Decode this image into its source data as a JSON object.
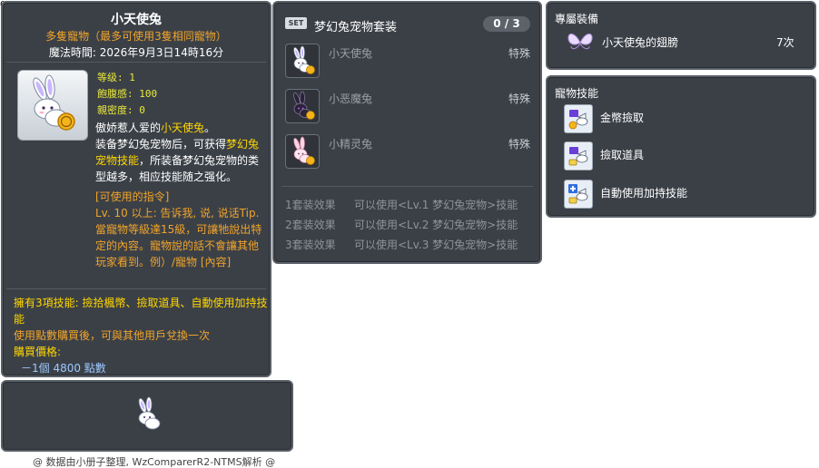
{
  "corner_id": "05002501",
  "item": {
    "title": "小天使兔",
    "subtitle": "多隻寵物（最多可使用3隻相同寵物）",
    "magic_time": "魔法時間:  2026年9月3日14時16分",
    "stats": {
      "level": "等级: 1",
      "fullness": "飽腹感: 100",
      "closeness": "親密度: 0"
    },
    "description": {
      "line1_pre": "傲娇惹人爱的",
      "line1_hl": "小天使兔",
      "line1_post": "。",
      "line2_pre": "装备梦幻兔宠物后，可获得",
      "line2_hl": "梦幻兔宠物技能",
      "line2_post": "，所装备梦幻兔宠物的类型越多，相应技能随之强化。"
    },
    "commands_header": "[可使用的指令]",
    "commands_body": "Lv. 10 以上:  告诉我, 说, 说话Tip. 當寵物等級達15級，可讓牠說出特定的內容。寵物說的話不會讓其他玩家看到。例）/寵物 [內容]",
    "skills_summary": "擁有3項技能: 撿拾楓幣、撿取道具、自動使用加持技能",
    "exchange_note": "使用點數購買後，可與其他用戶兌換一次",
    "price_label": "購買價格:",
    "price": "－1個 4800 點數"
  },
  "footer_credit": "@ 数据由小册子整理, WzComparerR2-NTMS解析 @",
  "set": {
    "badge": "SET",
    "name": "梦幻兔宠物套装",
    "count": "0 / 3",
    "items": [
      {
        "name": "小天使兔",
        "type": "特殊",
        "icon": "white-rabbit-icon"
      },
      {
        "name": "小恶魔兔",
        "type": "特殊",
        "icon": "black-rabbit-icon"
      },
      {
        "name": "小精灵兔",
        "type": "特殊",
        "icon": "pink-rabbit-icon"
      }
    ],
    "effects": [
      {
        "label": "1套装效果",
        "text": "可以使用<Lv.1 梦幻兔宠物>技能"
      },
      {
        "label": "2套装效果",
        "text": "可以使用<Lv.2 梦幻兔宠物>技能"
      },
      {
        "label": "3套装效果",
        "text": "可以使用<Lv.3 梦幻兔宠物>技能"
      }
    ]
  },
  "exclusive_equip": {
    "header": "專屬裝備",
    "name": "小天使兔的翅膀",
    "count": "7次",
    "icon": "wings-icon"
  },
  "pet_skills": {
    "header": "寵物技能",
    "items": [
      {
        "name": "金幣撿取",
        "icon": "meso-pickup-icon"
      },
      {
        "name": "撿取道具",
        "icon": "item-pickup-icon"
      },
      {
        "name": "自動使用加持技能",
        "icon": "auto-buff-icon"
      }
    ]
  },
  "colors": {
    "panel_bg": "#3b4047",
    "orange": "#f0a42a",
    "yellow": "#ffd700",
    "price_blue": "#9ec8ff"
  }
}
